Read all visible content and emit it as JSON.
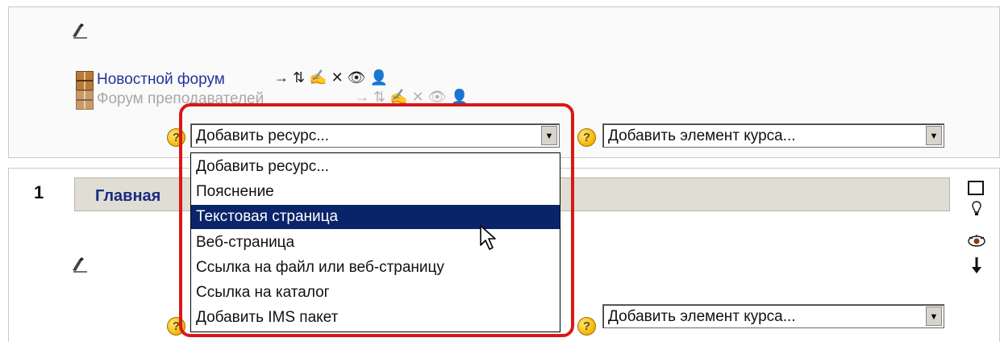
{
  "section0": {
    "forums": [
      {
        "name": "Новостной форум",
        "controls": [
          "→",
          "⇅",
          "✍",
          "✕",
          "👁",
          "👤"
        ]
      },
      {
        "name": "Форум преподавателей",
        "controls": [
          "→",
          "⇅",
          "✍",
          "✕",
          "👁",
          "👤"
        ]
      }
    ],
    "add_resource_select": {
      "value": "Добавить ресурс..."
    },
    "add_activity_select": {
      "value": "Добавить элемент курса..."
    }
  },
  "dropdown": {
    "options": [
      "Добавить ресурс...",
      "Пояснение",
      "Текстовая страница",
      "Веб-страница",
      "Ссылка на файл или веб-страницу",
      "Ссылка на каталог",
      "Добавить IMS пакет"
    ],
    "highlighted_index": 2
  },
  "section1": {
    "number": "1",
    "title": "Главная",
    "add_activity_select": {
      "value": "Добавить элемент курса..."
    },
    "right_icons": [
      "square-icon",
      "lightbulb-icon",
      "eye-icon",
      "arrow-down-icon"
    ]
  },
  "colors": {
    "highlight_border": "#d81818",
    "selection": "#0a246a",
    "link": "#223399"
  },
  "help_glyph": "?"
}
